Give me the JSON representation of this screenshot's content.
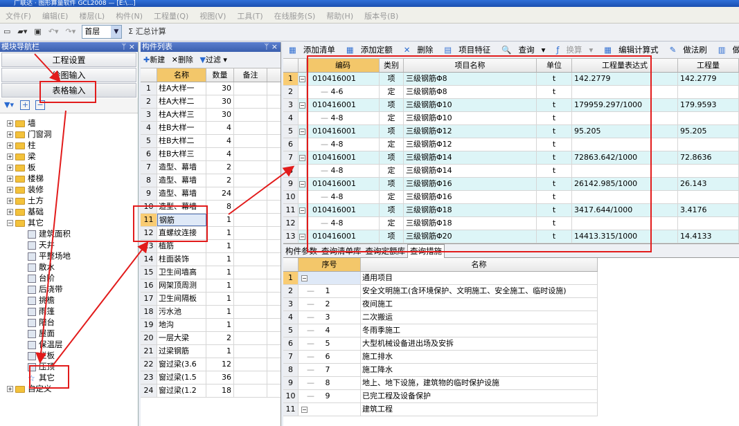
{
  "window": {
    "title": "广联达 · 图形算量软件 GCL2008 — [E:\\...]"
  },
  "menu": [
    "文件(F)",
    "编辑(E)",
    "楼层(L)",
    "构件(N)",
    "工程量(Q)",
    "视图(V)",
    "工具(T)",
    "在线服务(S)",
    "帮助(H)",
    "版本号(B)"
  ],
  "toolbar": {
    "floor": "首层",
    "sum_label": "汇总计算"
  },
  "module_nav": {
    "title": "模块导航栏",
    "buttons": [
      "工程设置",
      "绘图输入",
      "表格输入"
    ]
  },
  "tree": {
    "folders": [
      "墙",
      "门窗洞",
      "柱",
      "梁",
      "板",
      "楼梯",
      "装修",
      "土方",
      "基础",
      "其它"
    ],
    "children": [
      "建筑面积",
      "天井",
      "平整场地",
      "散水",
      "台阶",
      "后浇带",
      "挑檐",
      "雨篷",
      "阳台",
      "屋面",
      "保温层",
      "栏板",
      "压顶",
      "其它"
    ],
    "last": "自定义"
  },
  "component_list": {
    "title": "构件列表",
    "new": "新建",
    "delete": "删除",
    "filter": "过滤",
    "headers": [
      "名称",
      "数量",
      "备注"
    ],
    "rows": [
      {
        "n": "1",
        "name": "柱A大样一",
        "qty": "30"
      },
      {
        "n": "2",
        "name": "柱A大样二",
        "qty": "30"
      },
      {
        "n": "3",
        "name": "柱A大样三",
        "qty": "30"
      },
      {
        "n": "4",
        "name": "柱B大样一",
        "qty": "4"
      },
      {
        "n": "5",
        "name": "柱B大样二",
        "qty": "4"
      },
      {
        "n": "6",
        "name": "柱B大样三",
        "qty": "4"
      },
      {
        "n": "7",
        "name": "造型、幕墙",
        "qty": "2"
      },
      {
        "n": "8",
        "name": "造型、幕墙",
        "qty": "2"
      },
      {
        "n": "9",
        "name": "造型、幕墙",
        "qty": "24"
      },
      {
        "n": "10",
        "name": "造型、幕墙",
        "qty": "8"
      },
      {
        "n": "11",
        "name": "钢筋",
        "qty": "1"
      },
      {
        "n": "12",
        "name": "直螺纹连接",
        "qty": "1"
      },
      {
        "n": "13",
        "name": "植筋",
        "qty": "1"
      },
      {
        "n": "14",
        "name": "柱面装饰",
        "qty": "1"
      },
      {
        "n": "15",
        "name": "卫生间墙高",
        "qty": "1"
      },
      {
        "n": "16",
        "name": "网架顶周测",
        "qty": "1"
      },
      {
        "n": "17",
        "name": "卫生间隔板",
        "qty": "1"
      },
      {
        "n": "18",
        "name": "污水池",
        "qty": "1"
      },
      {
        "n": "19",
        "name": "地沟",
        "qty": "1"
      },
      {
        "n": "20",
        "name": "一层大梁",
        "qty": "2"
      },
      {
        "n": "21",
        "name": "过梁钢筋",
        "qty": "1"
      },
      {
        "n": "22",
        "name": "窗过梁(3.6",
        "qty": "12"
      },
      {
        "n": "23",
        "name": "窗过梁(1.5",
        "qty": "36"
      },
      {
        "n": "24",
        "name": "窗过梁(1.2",
        "qty": "18"
      }
    ]
  },
  "right_toolbar": [
    "添加清单",
    "添加定额",
    "删除",
    "项目特征",
    "查询",
    "换算",
    "编辑计算式",
    "做法刷",
    "做法查询"
  ],
  "quantity_table": {
    "headers": [
      "编码",
      "类别",
      "项目名称",
      "单位",
      "工程量表达式",
      "工程量"
    ],
    "rows": [
      {
        "n": "1",
        "code": "010416001",
        "type": "项",
        "name": "三级钢筋Φ8",
        "unit": "t",
        "expr": "142.2779",
        "qty": "142.2779",
        "item": true
      },
      {
        "n": "2",
        "code": "4-6",
        "type": "定",
        "name": "三级钢筋Φ8",
        "unit": "t",
        "expr": "",
        "qty": "",
        "item": false
      },
      {
        "n": "3",
        "code": "010416001",
        "type": "项",
        "name": "三级钢筋Φ10",
        "unit": "t",
        "expr": "179959.297/1000",
        "qty": "179.9593",
        "item": true
      },
      {
        "n": "4",
        "code": "4-8",
        "type": "定",
        "name": "三级钢筋Φ10",
        "unit": "t",
        "expr": "",
        "qty": "",
        "item": false
      },
      {
        "n": "5",
        "code": "010416001",
        "type": "项",
        "name": "三级钢筋Φ12",
        "unit": "t",
        "expr": "95.205",
        "qty": "95.205",
        "item": true
      },
      {
        "n": "6",
        "code": "4-8",
        "type": "定",
        "name": "三级钢筋Φ12",
        "unit": "t",
        "expr": "",
        "qty": "",
        "item": false
      },
      {
        "n": "7",
        "code": "010416001",
        "type": "项",
        "name": "三级钢筋Φ14",
        "unit": "t",
        "expr": "72863.642/1000",
        "qty": "72.8636",
        "item": true
      },
      {
        "n": "8",
        "code": "4-8",
        "type": "定",
        "name": "三级钢筋Φ14",
        "unit": "t",
        "expr": "",
        "qty": "",
        "item": false
      },
      {
        "n": "9",
        "code": "010416001",
        "type": "项",
        "name": "三级钢筋Φ16",
        "unit": "t",
        "expr": "26142.985/1000",
        "qty": "26.143",
        "item": true
      },
      {
        "n": "10",
        "code": "4-8",
        "type": "定",
        "name": "三级钢筋Φ16",
        "unit": "t",
        "expr": "",
        "qty": "",
        "item": false
      },
      {
        "n": "11",
        "code": "010416001",
        "type": "项",
        "name": "三级钢筋Φ18",
        "unit": "t",
        "expr": "3417.644/1000",
        "qty": "3.4176",
        "item": true
      },
      {
        "n": "12",
        "code": "4-8",
        "type": "定",
        "name": "三级钢筋Φ18",
        "unit": "t",
        "expr": "",
        "qty": "",
        "item": false
      },
      {
        "n": "13",
        "code": "010416001",
        "type": "项",
        "name": "三级钢筋Φ20",
        "unit": "t",
        "expr": "14413.315/1000",
        "qty": "14.4133",
        "item": true
      }
    ]
  },
  "bottom_tabs": [
    "构件参数",
    "查询清单库",
    "查询定额库",
    "查询措施"
  ],
  "measures_table": {
    "headers": [
      "序号",
      "名称"
    ],
    "rows": [
      {
        "n": "1",
        "seq": "",
        "name": "通用项目",
        "group": true
      },
      {
        "n": "2",
        "seq": "1",
        "name": "安全文明施工(含环境保护、文明施工、安全施工、临时设施)",
        "group": false
      },
      {
        "n": "3",
        "seq": "2",
        "name": "夜间施工",
        "group": false
      },
      {
        "n": "4",
        "seq": "3",
        "name": "二次搬运",
        "group": false
      },
      {
        "n": "5",
        "seq": "4",
        "name": "冬雨季施工",
        "group": false
      },
      {
        "n": "6",
        "seq": "5",
        "name": "大型机械设备进出场及安拆",
        "group": false
      },
      {
        "n": "7",
        "seq": "6",
        "name": "施工排水",
        "group": false
      },
      {
        "n": "8",
        "seq": "7",
        "name": "施工降水",
        "group": false
      },
      {
        "n": "9",
        "seq": "8",
        "name": "地上、地下设施，建筑物的临时保护设施",
        "group": false
      },
      {
        "n": "10",
        "seq": "9",
        "name": "已完工程及设备保护",
        "group": false
      },
      {
        "n": "11",
        "seq": "",
        "name": "建筑工程",
        "group": true
      }
    ]
  }
}
